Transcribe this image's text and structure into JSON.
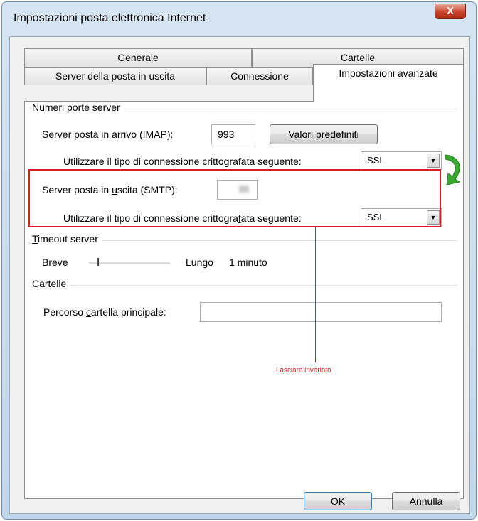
{
  "window": {
    "title": "Impostazioni posta elettronica Internet",
    "close_label": "X"
  },
  "tabs": {
    "row1": [
      "Generale",
      "Cartelle"
    ],
    "row2": [
      "Server della posta in uscita",
      "Connessione",
      "Impostazioni avanzate"
    ],
    "active": "Impostazioni avanzate"
  },
  "ports": {
    "group_label": "Numeri porte server",
    "imap": {
      "pre": "Server posta in ",
      "key": "a",
      "post": "rrivo (IMAP):",
      "value": "993"
    },
    "defaults_button": {
      "key": "V",
      "rest": "alori predefiniti"
    },
    "imap_encryption": {
      "pre": "Utilizzare il tipo di conne",
      "key": "s",
      "post": "sione crittografata seguente:",
      "value": "SSL"
    },
    "smtp": {
      "pre": "Server posta in ",
      "key": "u",
      "post": "scita (SMTP):",
      "value": "25"
    },
    "smtp_encryption": {
      "pre": "Utilizzare il tipo di connessione crittogra",
      "key": "f",
      "post": "ata seguente:",
      "value": "SSL"
    }
  },
  "timeout": {
    "group_key": "T",
    "group_rest": "imeout server",
    "short": "Breve",
    "long": "Lungo",
    "value_text": "1 minuto",
    "level": 0.1
  },
  "folders": {
    "group_label": "Cartelle",
    "root_pre": "Percorso ",
    "root_key": "c",
    "root_post": "artella principale:",
    "root_value": ""
  },
  "annotation": {
    "text": "Lasciare invariato",
    "color": "#d61e25"
  },
  "buttons": {
    "ok": "OK",
    "cancel": "Annulla"
  },
  "colors": {
    "arrow": "#3aa82f",
    "highlight": "#d61e25"
  }
}
